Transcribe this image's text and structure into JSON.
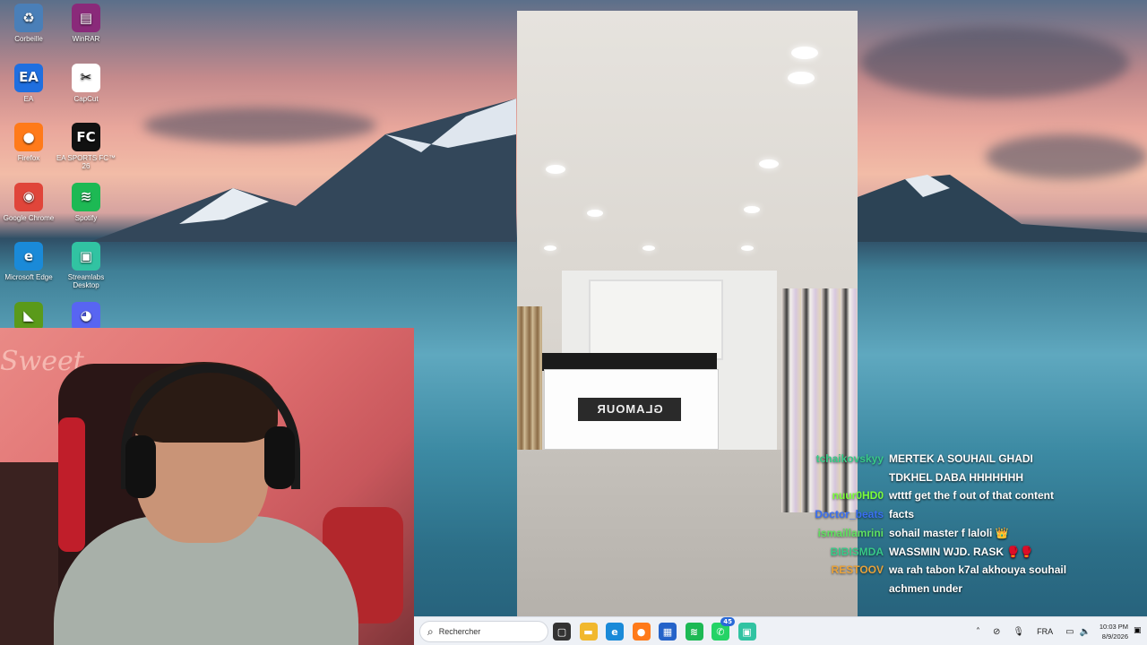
{
  "desktop": {
    "icons": [
      {
        "label": "Corbeille",
        "icon": "recycle-bin-icon",
        "glyph": "♻",
        "color": "#4a7fb8"
      },
      {
        "label": "WinRAR",
        "icon": "winrar-icon",
        "glyph": "▤",
        "color": "#8a2a7a"
      },
      {
        "label": "EA",
        "icon": "ea-icon",
        "glyph": "EA",
        "color": "#1f6fe0"
      },
      {
        "label": "CapCut",
        "icon": "capcut-icon",
        "glyph": "✂",
        "color": "#ffffff"
      },
      {
        "label": "Firefox",
        "icon": "firefox-icon",
        "glyph": "●",
        "color": "#ff7a1a"
      },
      {
        "label": "EA SPORTS FC™ 26",
        "icon": "ea-sports-fc-icon",
        "glyph": "FC",
        "color": "#111111"
      },
      {
        "label": "Google Chrome",
        "icon": "chrome-icon",
        "glyph": "◉",
        "color": "#e0453a"
      },
      {
        "label": "Spotify",
        "icon": "spotify-icon",
        "glyph": "≋",
        "color": "#1db954"
      },
      {
        "label": "Microsoft Edge",
        "icon": "edge-icon",
        "glyph": "e",
        "color": "#1a8ad8"
      },
      {
        "label": "Streamlabs Desktop",
        "icon": "streamlabs-icon",
        "glyph": "▣",
        "color": "#31c3a2"
      },
      {
        "label": "",
        "icon": "nvidia-icon",
        "glyph": "◣",
        "color": "#5a9a1a"
      },
      {
        "label": "",
        "icon": "discord-icon",
        "glyph": "◕",
        "color": "#5865f2"
      }
    ]
  },
  "video": {
    "store_sign": "GLAMOUR"
  },
  "webcam": {
    "logo_text": "Sweet"
  },
  "chat": {
    "messages": [
      {
        "user": "tchaikovskyy",
        "color": "#38c987",
        "text": "MERTEK A SOUHAIL GHADI"
      },
      {
        "user": "",
        "color": "#38c987",
        "text": "TDKHEL DABA HHHHHHH"
      },
      {
        "user": "nuur0HD0",
        "color": "#7cff3a",
        "text": "wtttf get the f out of that content"
      },
      {
        "user": "Doctor_beats",
        "color": "#3a6ff0",
        "text": "facts"
      },
      {
        "user": "ismaillamrini",
        "color": "#5fe05f",
        "text": "sohail master f laloli 👑"
      },
      {
        "user": "BIBISMDA",
        "color": "#38c987",
        "text": "WASSMIN WJD. RASK 🥊🥊"
      },
      {
        "user": "RESTOOV",
        "color": "#e8a23a",
        "text": "wa rah tabon k7al akhouya souhail"
      },
      {
        "user": "",
        "color": "#e8a23a",
        "text": "achmen under"
      }
    ]
  },
  "taskbar": {
    "search_placeholder": "Rechercher",
    "apps": [
      {
        "name": "task-view-icon",
        "glyph": "▢",
        "color": "#333333"
      },
      {
        "name": "file-explorer-icon",
        "glyph": "▬",
        "color": "#f1b82d"
      },
      {
        "name": "edge-taskbar-icon",
        "glyph": "e",
        "color": "#1a8ad8"
      },
      {
        "name": "firefox-taskbar-icon",
        "glyph": "●",
        "color": "#ff7a1a"
      },
      {
        "name": "store-taskbar-icon",
        "glyph": "▦",
        "color": "#2563c9"
      },
      {
        "name": "spotify-taskbar-icon",
        "glyph": "≋",
        "color": "#1db954"
      },
      {
        "name": "whatsapp-taskbar-icon",
        "glyph": "✆",
        "color": "#25d366",
        "badge": "45"
      },
      {
        "name": "streamlabs-taskbar-icon",
        "glyph": "▣",
        "color": "#31c3a2"
      }
    ],
    "language": "FRA",
    "time": "10:03 PM",
    "date": "8/9/2026"
  }
}
